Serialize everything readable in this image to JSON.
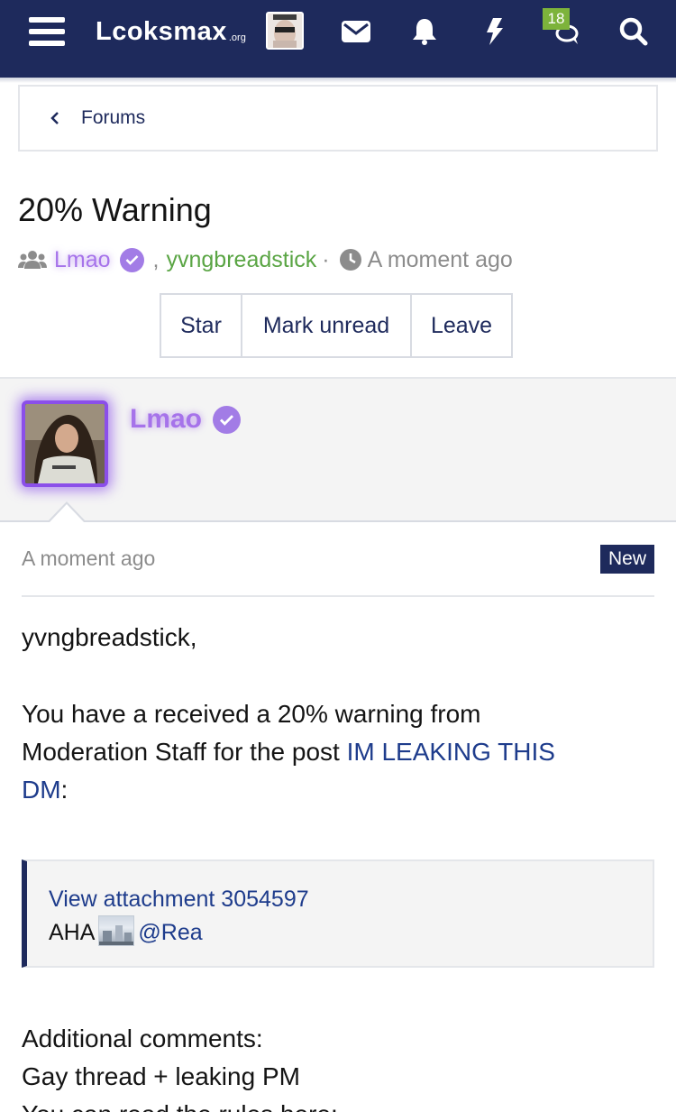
{
  "nav": {
    "logo_main": "Lcoksmax",
    "logo_suffix": ".org",
    "notification_badge": "18",
    "icons": [
      "menu-icon",
      "envelope-icon",
      "bell-icon",
      "bolt-icon",
      "chat-bubbles-icon",
      "search-icon"
    ]
  },
  "breadcrumb": {
    "label": "Forums"
  },
  "thread": {
    "title": "20% Warning",
    "participant_1": "Lmao",
    "separator": ",",
    "participant_2": "yvngbreadstick",
    "dot": "·",
    "time": "A moment ago"
  },
  "actions": {
    "star": "Star",
    "mark_unread": "Mark unread",
    "leave": "Leave"
  },
  "message": {
    "author": "Lmao",
    "time": "A moment ago",
    "badge": "New",
    "greeting": "yvngbreadstick,",
    "line1": "You have a received a 20% warning from",
    "line2_prefix": "Moderation Staff for the post ",
    "post_link_a": "IM LEAKING THIS",
    "post_link_b": "DM",
    "post_suffix": ":",
    "quote_link": "View attachment 3054597",
    "quote_text_prefix": "AHA",
    "quote_mention": "@Rea",
    "comments_label": "Additional comments:",
    "comments_text": "Gay thread + leaking PM",
    "rules_text": "You can read the rules here:"
  },
  "colors": {
    "nav_bg": "#1e2a5c",
    "accent_purple": "#a673ea",
    "accent_green": "#5aa544",
    "badge_green": "#7db33b"
  }
}
